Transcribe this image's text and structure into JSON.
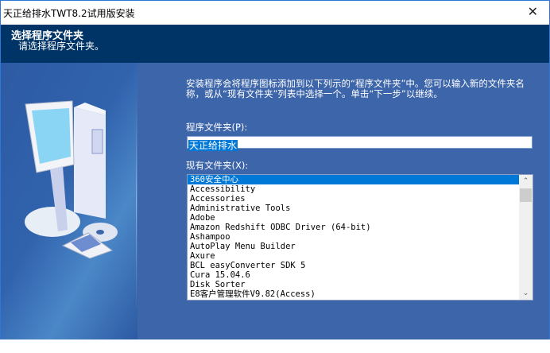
{
  "window": {
    "title": "天正给排水TWT8.2试用版安装",
    "close_glyph": "✕"
  },
  "header": {
    "title": "选择程序文件夹",
    "subtitle": "请选择程序文件夹。"
  },
  "main": {
    "description": "安装程序会将程序图标添加到以下列示的“程序文件夹”中。您可以输入新的文件夹名称，或从“现有文件夹”列表中选择一个。单击“下一步”以继续。",
    "program_folder_label": "程序文件夹(P):",
    "program_folder_value": "天正给排水",
    "existing_folders_label": "现有文件夹(X):",
    "existing_folders": [
      "360安全中心",
      "Accessibility",
      "Accessories",
      "Administrative Tools",
      "Adobe",
      "Amazon Redshift ODBC Driver (64-bit)",
      "Ashampoo",
      "AutoPlay Menu Builder",
      "Axure",
      "BCL easyConverter SDK 5",
      "Cura 15.04.6",
      "Disk Sorter",
      "E8客户管理软件V9.82(Access)"
    ],
    "selected_index": 0
  },
  "scrollbar": {
    "up": "⌃",
    "down": "⌄"
  }
}
